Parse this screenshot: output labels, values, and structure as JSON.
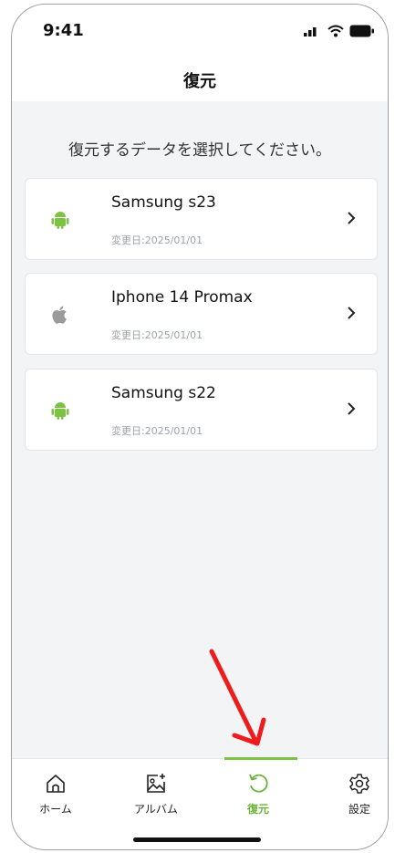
{
  "status_bar": {
    "time": "9:41",
    "icons": [
      "signal-icon",
      "wifi-icon",
      "battery-icon"
    ]
  },
  "header": {
    "title": "復元"
  },
  "instruction": "復元するデータを選択してください。",
  "devices": [
    {
      "name": "Samsung s23",
      "date": "変更日:2025/01/01",
      "icon": "android-icon"
    },
    {
      "name": "Iphone 14 Promax",
      "date": "変更日:2025/01/01",
      "icon": "apple-icon"
    },
    {
      "name": "Samsung s22",
      "date": "変更日:2025/01/01",
      "icon": "android-icon"
    }
  ],
  "bottom_nav": {
    "items": [
      {
        "label": "ホーム",
        "icon": "home-icon"
      },
      {
        "label": "アルバム",
        "icon": "album-add-icon"
      },
      {
        "label": "復元",
        "icon": "restore-icon",
        "active": true
      },
      {
        "label": "設定",
        "icon": "gear-icon"
      }
    ]
  },
  "colors": {
    "accent": "#6ab338",
    "android": "#7cc243",
    "apple": "#9a9a9a",
    "annotation_arrow": "#ee1c1c"
  }
}
